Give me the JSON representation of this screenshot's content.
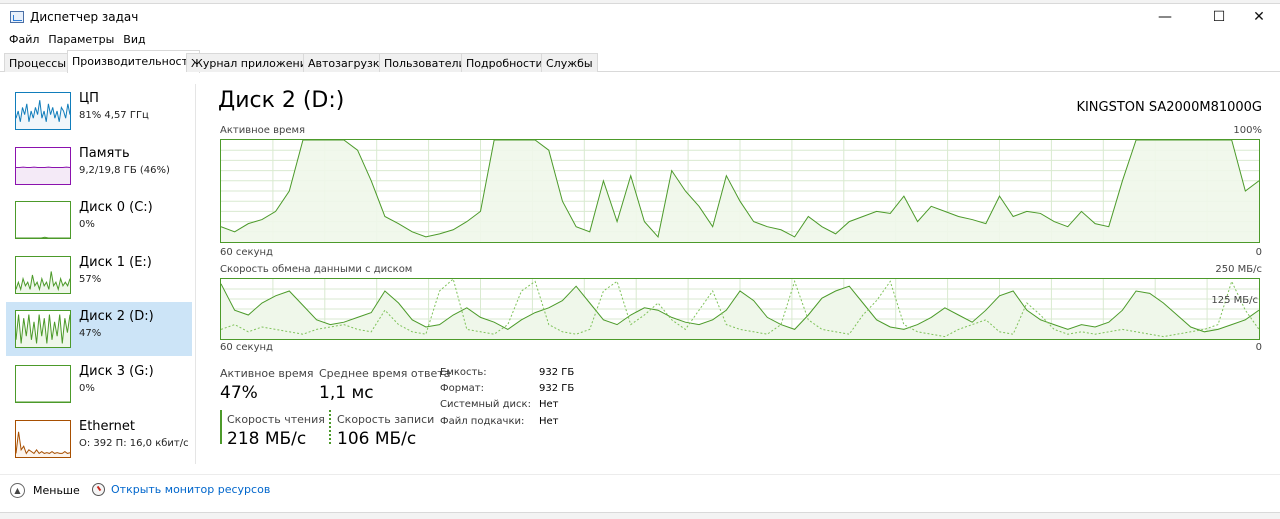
{
  "window": {
    "title": "Диспетчер задач",
    "minimize_glyph": "—",
    "maximize_glyph": "☐",
    "close_glyph": "✕"
  },
  "menu": [
    "Файл",
    "Параметры",
    "Вид"
  ],
  "tabs": [
    {
      "label": "Процессы",
      "active": false
    },
    {
      "label": "Производительность",
      "active": true
    },
    {
      "label": "Журнал приложений",
      "active": false
    },
    {
      "label": "Автозагрузка",
      "active": false
    },
    {
      "label": "Пользователи",
      "active": false
    },
    {
      "label": "Подробности",
      "active": false
    },
    {
      "label": "Службы",
      "active": false
    }
  ],
  "sidebar": [
    {
      "name": "ЦП",
      "sub": "81% 4,57 ГГц",
      "color": "#117dbb",
      "fill": "#f1f6fa",
      "selected": false,
      "spark": [
        0.3,
        0.5,
        0.2,
        0.6,
        0.4,
        0.7,
        0.2,
        0.5,
        0.3,
        0.6,
        0.4,
        0.8,
        0.3,
        0.5,
        0.2,
        0.7,
        0.4,
        0.6,
        0.3,
        0.5,
        0.2,
        0.6,
        0.5,
        0.3,
        0.7,
        0.4
      ]
    },
    {
      "name": "Память",
      "sub": "9,2/19,8 ГБ (46%)",
      "color": "#8b12ae",
      "fill": "#f4eaf7",
      "selected": false,
      "spark": [
        0.46,
        0.46,
        0.47,
        0.46,
        0.46,
        0.47,
        0.46,
        0.46,
        0.46,
        0.47,
        0.46,
        0.46,
        0.46,
        0.46,
        0.47,
        0.46
      ]
    },
    {
      "name": "Диск 0 (C:)",
      "sub": "0%",
      "color": "#4c9a2a",
      "fill": "#eff7ea",
      "selected": false,
      "spark": [
        0,
        0,
        0,
        0,
        0,
        0,
        0,
        0,
        0.02,
        0,
        0,
        0,
        0,
        0,
        0,
        0
      ]
    },
    {
      "name": "Диск 1 (E:)",
      "sub": "57%",
      "color": "#4c9a2a",
      "fill": "#eff7ea",
      "selected": false,
      "spark": [
        0.1,
        0.3,
        0.1,
        0.4,
        0.2,
        0.3,
        0.1,
        0.5,
        0.2,
        0.3,
        0.1,
        0.4,
        0.2,
        0.3,
        0.1,
        0.6,
        0.2,
        0.3,
        0.1,
        0.4,
        0.2,
        0.3,
        0.2,
        0.4
      ]
    },
    {
      "name": "Диск 2 (D:)",
      "sub": "47%",
      "color": "#4c9a2a",
      "fill": "#eff7ea",
      "selected": true,
      "spark": [
        0.2,
        0.9,
        0.1,
        0.8,
        0.3,
        0.9,
        0.2,
        0.7,
        0.1,
        0.9,
        0.3,
        0.8,
        0.1,
        0.9,
        0.2,
        0.7,
        0.3,
        0.9,
        0.1,
        0.8,
        0.4,
        0.9
      ]
    },
    {
      "name": "Диск 3 (G:)",
      "sub": "0%",
      "color": "#4c9a2a",
      "fill": "#eff7ea",
      "selected": false,
      "spark": [
        0,
        0,
        0,
        0,
        0,
        0,
        0,
        0,
        0,
        0,
        0,
        0,
        0,
        0,
        0,
        0
      ]
    },
    {
      "name": "Ethernet",
      "sub": "О: 392 П: 16,0 кбит/с",
      "color": "#a74f01",
      "fill": "#fcf3eb",
      "selected": false,
      "spark": [
        0.1,
        0.7,
        0.2,
        0.3,
        0.1,
        0.2,
        0.15,
        0.1,
        0.2,
        0.1,
        0.15,
        0.1,
        0.12,
        0.1,
        0.15,
        0.1,
        0.12,
        0.1,
        0.1,
        0.15,
        0.1,
        0.12
      ]
    }
  ],
  "main": {
    "title": "Диск 2 (D:)",
    "model": "KINGSTON SA2000M81000G",
    "active_chart": {
      "label": "Активное время",
      "max_label": "100%",
      "time_label": "60 секунд",
      "min_label": "0"
    },
    "transfer_chart": {
      "label": "Скорость обмена данными с диском",
      "max_label": "250 МБ/с",
      "mid_label": "125 МБ/с",
      "time_label": "60 секунд",
      "min_label": "0"
    },
    "stats": {
      "active_time_label": "Активное время",
      "active_time_value": "47%",
      "response_label": "Среднее время ответа",
      "response_value": "1,1 мс",
      "read_label": "Скорость чтения",
      "read_value": "218 МБ/с",
      "write_label": "Скорость записи",
      "write_value": "106 МБ/с"
    },
    "info": [
      {
        "label": "Емкость:",
        "value": "932 ГБ"
      },
      {
        "label": "Формат:",
        "value": "932 ГБ"
      },
      {
        "label": "Системный диск:",
        "value": "Нет"
      },
      {
        "label": "Файл подкачки:",
        "value": "Нет"
      }
    ]
  },
  "footer": {
    "less_label": "Меньше",
    "monitor_label": "Открыть монитор ресурсов"
  },
  "colors": {
    "disk_line": "#4c9a2a",
    "disk_fill": "#eff7ea",
    "grid": "#d9ead0",
    "link": "#0066cc",
    "selected_bg": "#cce4f7"
  },
  "chart_data": [
    {
      "type": "area",
      "title": "Активное время",
      "ylim": [
        0,
        100
      ],
      "x_span_seconds": 60,
      "values": [
        15,
        10,
        18,
        22,
        30,
        50,
        100,
        100,
        100,
        100,
        90,
        60,
        25,
        18,
        10,
        5,
        8,
        12,
        20,
        30,
        100,
        100,
        100,
        100,
        90,
        40,
        15,
        10,
        60,
        20,
        65,
        20,
        5,
        70,
        50,
        35,
        15,
        65,
        40,
        20,
        15,
        12,
        5,
        25,
        15,
        8,
        20,
        25,
        30,
        28,
        45,
        20,
        35,
        30,
        25,
        22,
        18,
        45,
        25,
        30,
        28,
        20,
        15,
        30,
        18,
        15,
        60,
        100,
        100,
        100,
        100,
        100,
        100,
        100,
        100,
        50,
        60
      ]
    },
    {
      "type": "line",
      "title": "Скорость обмена данными с диском",
      "ylim": [
        0,
        250
      ],
      "series": [
        {
          "name": "Скорость чтения",
          "values": [
            230,
            120,
            100,
            150,
            180,
            200,
            140,
            80,
            60,
            70,
            90,
            110,
            200,
            150,
            80,
            50,
            60,
            100,
            130,
            90,
            70,
            40,
            80,
            110,
            130,
            160,
            220,
            150,
            80,
            60,
            100,
            130,
            120,
            90,
            70,
            60,
            80,
            120,
            200,
            160,
            90,
            60,
            40,
            100,
            170,
            200,
            220,
            150,
            80,
            50,
            40,
            60,
            90,
            130,
            100,
            70,
            120,
            180,
            200,
            120,
            80,
            60,
            40,
            60,
            50,
            70,
            120,
            200,
            190,
            150,
            100,
            50,
            30,
            40,
            60,
            80,
            120
          ]
        },
        {
          "name": "Скорость записи",
          "values": [
            40,
            60,
            30,
            50,
            40,
            30,
            20,
            40,
            50,
            60,
            40,
            30,
            120,
            60,
            30,
            20,
            200,
            250,
            40,
            30,
            20,
            60,
            200,
            240,
            60,
            30,
            20,
            40,
            200,
            240,
            60,
            100,
            150,
            80,
            40,
            120,
            200,
            60,
            40,
            30,
            20,
            60,
            240,
            80,
            40,
            30,
            20,
            100,
            160,
            240,
            60,
            30,
            20,
            10,
            40,
            60,
            80,
            30,
            20,
            150,
            100,
            40,
            20,
            30,
            20,
            30,
            40,
            30,
            20,
            10,
            20,
            30,
            40,
            60,
            240,
            120,
            40
          ]
        }
      ]
    }
  ]
}
